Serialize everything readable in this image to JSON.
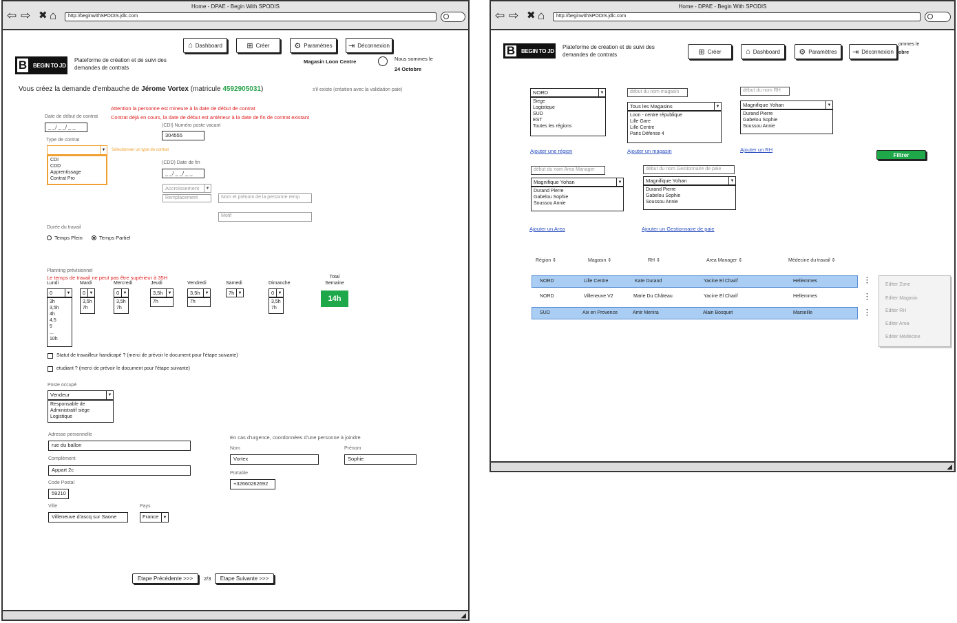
{
  "left": {
    "window_title": "Home - DPAE - Begin With SPODIS",
    "url": "http://beginwithSPODIS.jdlc.com",
    "logo_letter": "B",
    "logo_text": "BEGIN TO JD",
    "tagline": "Plateforme de création et de suivi des demandes de contrats",
    "nav": {
      "dashboard": "Dashboard",
      "creer": "Créer",
      "parametres": "Paramètres",
      "deconnexion": "Déconnexion"
    },
    "magasin": "Magasin Loon Centre",
    "date_label": "Nous sommes le",
    "date_value": "24 Octobre",
    "heading_prefix": "Vous créez la demande d'embauche de",
    "employee_name": "Jérome Vortex",
    "matricule_prefix": "(matricule",
    "matricule": "4592905031",
    "matricule_suffix": ")",
    "exists_note": "s'il existe (création avec la validation paie)",
    "warning1": "Attention la personne est mineure à la date de début de contrat",
    "warning2": "Contrat déjà en cours, la date de début est antérieur à la date de fin de contrat existant",
    "start_date_label": "Date de début de contrat",
    "start_date_value": "_ _/ _ _/ _ _",
    "cdi_poste_label": "(CDI) Numéro poste vacant",
    "cdi_poste_value": "304555",
    "contract_type_label": "Type de contrat",
    "contract_type_hint": "Sélectionner un type de contrat",
    "contract_types": [
      "CDI",
      "CDD",
      "Apprentissage",
      "Contrat Pro"
    ],
    "cdd_end_label": "(CDD) Date de fin",
    "cdd_end_value": "_ _/ _ _/ _ _",
    "accroissement": "Accroissement",
    "remplacement": "Remplacement",
    "replaced_person_placeholder": "Nom et prénom de la personne remp",
    "motif_placeholder": "Motif",
    "duree_label": "Durée du travail",
    "temps_plein": "Temps Plein",
    "temps_partiel": "Temps Partiel",
    "planning_label": "Planning prévisionnel",
    "planning_warning": "Le temps de travail ne peut pas être supérieur à 35H",
    "days": [
      {
        "name": "Lundi",
        "value": "0",
        "options": [
          "3h",
          "3,5h",
          "4h",
          "4,5",
          "5",
          "...",
          "10h"
        ]
      },
      {
        "name": "Mardi",
        "value": "0",
        "options": [
          "3,5h",
          "7h"
        ]
      },
      {
        "name": "Mercredi",
        "value": "0",
        "options": [
          "3,5h",
          "7h"
        ]
      },
      {
        "name": "Jeudi",
        "value": "3,5h",
        "options": [
          "7h"
        ]
      },
      {
        "name": "Vendredi",
        "value": "3,5h",
        "options": [
          "7h"
        ]
      },
      {
        "name": "Samedi",
        "value": "7h",
        "options": []
      },
      {
        "name": "Dimanche",
        "value": "0",
        "options": [
          "3,5h",
          "7h"
        ]
      }
    ],
    "total_label": "Total Semaine",
    "total_value": "14h",
    "handicap_label": "Statut de travailleur handicapé ? (merci de prévoir le document pour l'étape suivante)",
    "etudiant_label": "etudiant ? (merci de prévoir le document pour l'étape suivante)",
    "poste_label": "Poste occupé",
    "poste_value": "Vendeur",
    "poste_options": [
      "Responsable de",
      "Administratif siège",
      "Logistique"
    ],
    "adresse_label": "Adresse personnelle",
    "adresse_value": "rue du ballon",
    "complement_label": "Complément",
    "complement_value": "Appart 2c",
    "cp_label": "Code Postal",
    "cp_value": "59210",
    "ville_label": "Ville",
    "ville_value": "Villeneuve d'ascq sur Saone",
    "pays_label": "Pays",
    "pays_value": "France",
    "urgence_label": "En cas d'urgence, coordonnées d'une personne à joindre",
    "nom_label": "Nom",
    "nom_value": "Vortex",
    "prenom_label": "Prénom",
    "prenom_value": "Sophie",
    "portable_label": "Portable",
    "portable_value": "+32660262692",
    "prev_btn": "Etape Précédente >>>",
    "step": "2/3",
    "next_btn": "Etape Suivante >>>"
  },
  "right": {
    "window_title": "Home - DPAE - Begin With SPODIS",
    "url": "http://beginwithSPODIS.jdlc.com",
    "logo_letter": "B",
    "logo_text": "BEGIN TO JD",
    "tagline": "Plateforme de création et de suivi des demandes de contrats",
    "nav": {
      "creer": "Créer",
      "dashboard": "Dashboard",
      "parametres": "Paramètres",
      "deconnexion": "Déconnexion"
    },
    "date_partial_1": "ommes le",
    "date_partial_2": "obre",
    "region_select": "NORD",
    "region_options": [
      "Siege",
      "Logistique",
      "SUD",
      "EST",
      "Toutes les régions"
    ],
    "add_region": "Ajouter une région",
    "magasin_placeholder": "début du nom magasin",
    "magasin_select": "Tous les Magasins",
    "magasin_options": [
      "Loon - centre république",
      "Lille Gare",
      "Lille Centre",
      "Paris Défense 4"
    ],
    "add_magasin": "Ajouter un magasin",
    "rh_placeholder": "début du nom RH",
    "rh_select": "Magnifique Yohan",
    "rh_options": [
      "Durand Pierre",
      "Gabelou Sophie",
      "Soussou Annie"
    ],
    "add_rh": "Ajouter un RH",
    "filter_btn": "Filtrer",
    "area_placeholder": "début du nom Area Manager",
    "area_select": "Magnifique Yohan",
    "area_options": [
      "Durand Pierre",
      "Gabelou Sophie",
      "Soussou Annie"
    ],
    "add_area": "Ajouter un Area",
    "gest_placeholder": "début du nom Gestionnaire de paie",
    "gest_select": "Magnifique Yohan",
    "gest_options": [
      "Durand Pierre",
      "Gabelou Sophie",
      "Soussou Annie"
    ],
    "add_gest": "Ajouter un Gestionnaire de paie",
    "columns": [
      "Région",
      "Magasin",
      "RH",
      "Area Manager",
      "Médecine du travail"
    ],
    "rows": [
      [
        "NORD",
        "Lille Centre",
        "Kate Durand",
        "Yacine El Charif",
        "Hellemmes"
      ],
      [
        "NORD",
        "Villeneuve V2",
        "Marie Du Château",
        "Yacine El Charif",
        "Hellemmes"
      ],
      [
        "SUD",
        "Aix en Provence",
        "Amir Menira",
        "Alain Bosquet",
        "Marseille"
      ]
    ],
    "edit_menu": [
      "Editer Zone",
      "Editer Magasin",
      "Editer RH",
      "Editer Area",
      "Editer Médecine"
    ]
  }
}
